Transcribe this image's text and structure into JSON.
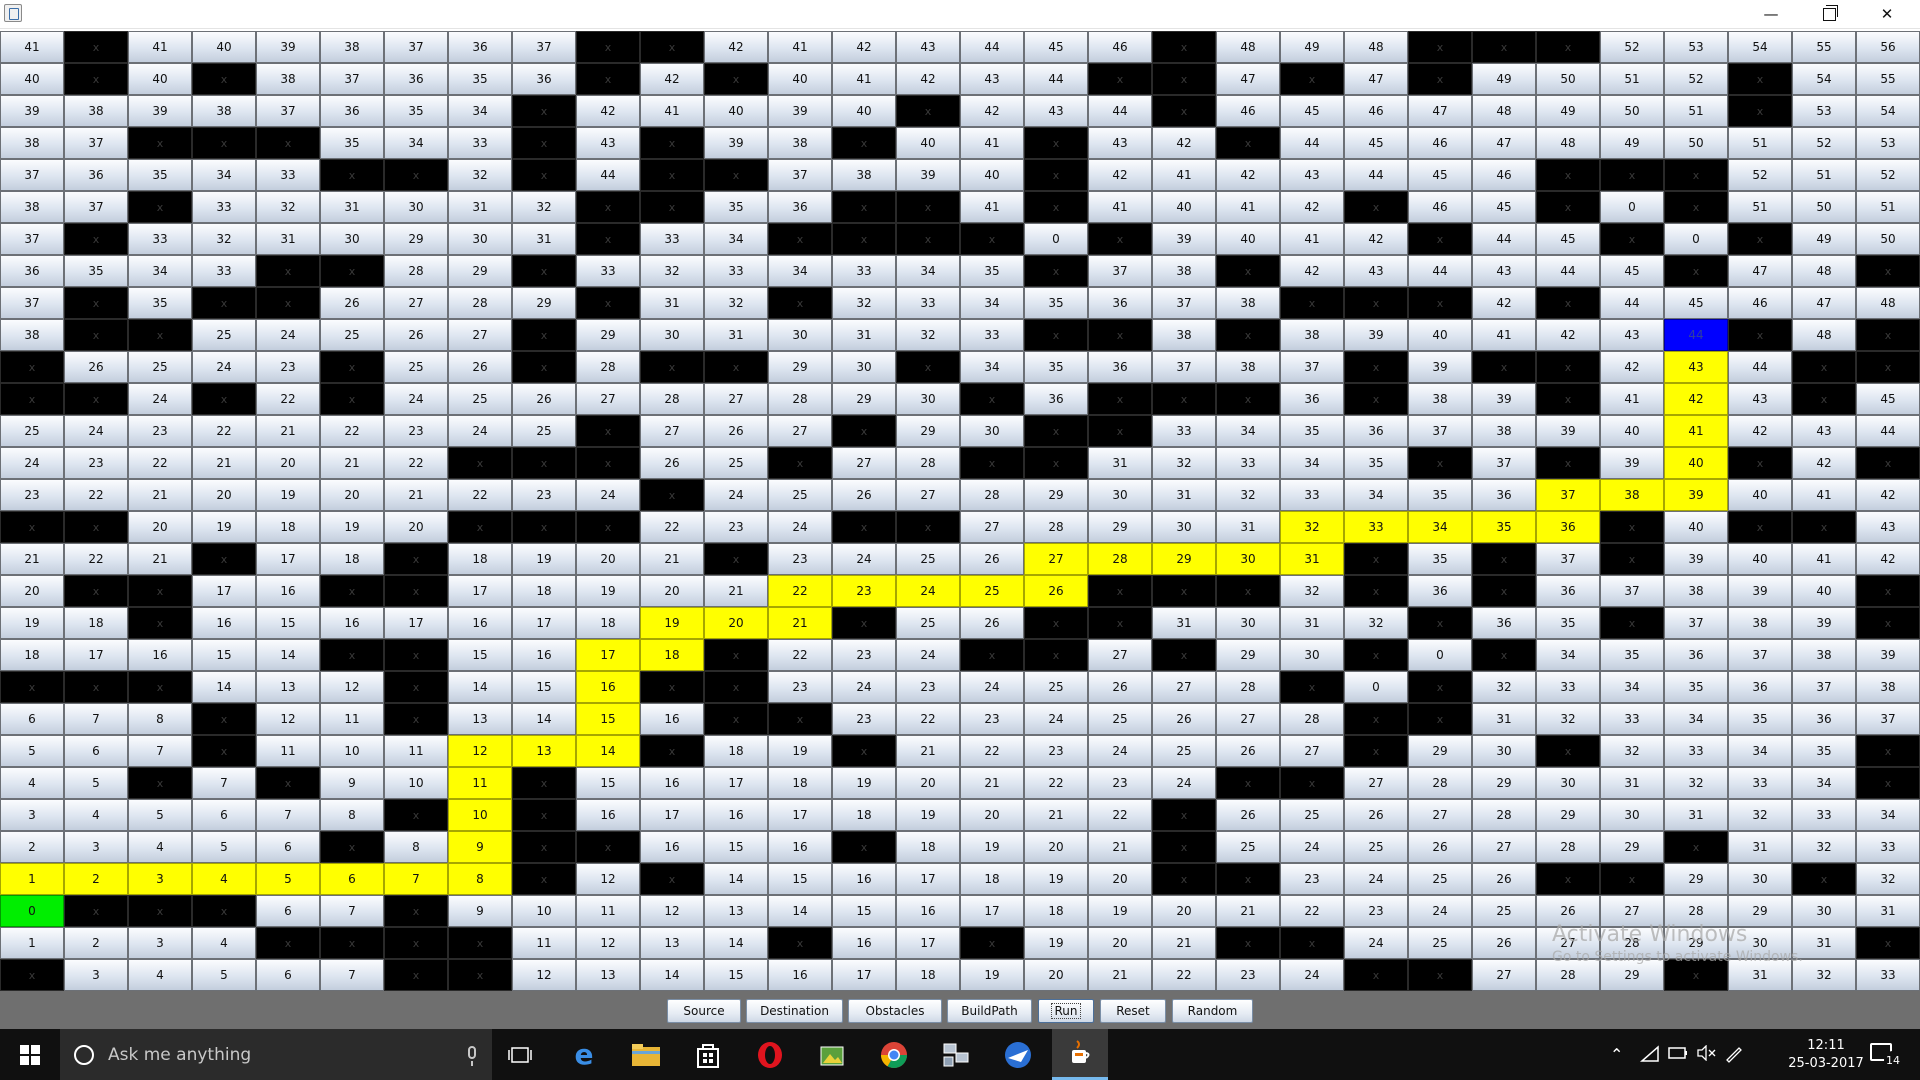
{
  "window": {
    "controls": {
      "minimize": "—",
      "close": "✕"
    }
  },
  "grid": {
    "rows": 30,
    "cols": 30,
    "obstacle_label": "x",
    "cells": [
      "41 x 41 40 39 38 37 36 37 x x 42 41 42 43 44 45 46 x 48 49 48 x x x 52 53 54 55 56",
      "40 x 40 x 38 37 36 35 36 x 42 x 40 41 42 43 44 x x 47 x 47 x 49 50 51 52 x 54 55",
      "39 38 39 38 37 36 35 34 x 42 41 40 39 40 x 42 43 44 x 46 45 46 47 48 49 50 51 x 53 54",
      "38 37 x x x 35 34 33 x 43 x 39 38 x 40 41 x 43 42 x 44 45 46 47 48 49 50 51 52 53",
      "37 36 35 34 33 x x 32 x 44 x x 37 38 39 40 x 42 41 42 43 44 45 46 x x x 52 51 52",
      "38 37 x 33 32 31 30 31 32 x x 35 36 x x 41 x 41 40 41 42 x 46 45 x 0 x 51 50 51",
      "37 x 33 32 31 30 29 30 31 x 33 34 x x x x 0 x 39 40 41 42 x 44 45 x 0 x 49 50",
      "36 35 34 33 x x 28 29 x 33 32 33 34 33 34 35 x 37 38 x 42 43 44 43 44 45 x 47 48 x",
      "37 x 35 x x 26 27 28 29 x 31 32 x 32 33 34 35 36 37 38 x x x 42 x 44 45 46 47 48",
      "38 x x 25 24 25 26 27 x 29 30 31 30 31 32 33 x x 38 x 38 39 40 41 42 43 44 x 48 x",
      "x 26 25 24 23 x 25 26 x 28 x x 29 30 x 34 35 36 37 38 37 x 39 x x 42 43 44 x x",
      "x x 24 x 22 x 24 25 26 27 28 27 28 29 30 x 36 x x x 36 x 38 39 x 41 42 43 x 45",
      "25 24 23 22 21 22 23 24 25 x 27 26 27 x 29 30 x x 33 34 35 36 37 38 39 40 41 42 43 44",
      "24 23 22 21 20 21 22 x x x 26 25 x 27 28 x x 31 32 33 34 35 x 37 x 39 40 x 42 x",
      "23 22 21 20 19 20 21 22 23 24 x 24 25 26 27 28 29 30 31 32 33 34 35 36 37 38 39 40 41 42",
      "x x 20 19 18 19 20 x x x 22 23 24 x x 27 28 29 30 31 32 33 34 35 36 x 40 x x 43",
      "21 22 21 x 17 18 x 18 19 20 21 x 23 24 25 26 27 28 29 30 31 x 35 x 37 x 39 40 41 42",
      "20 x x 17 16 x x 17 18 19 20 21 22 23 24 25 26 x x x 32 x 36 x 36 37 38 39 40 x",
      "19 18 x 16 15 16 17 16 17 18 19 20 21 x 25 26 x x 31 30 31 32 x 36 35 x 37 38 39 x",
      "18 17 16 15 14 x x 15 16 17 18 x 22 23 24 x x 27 x 29 30 x 0 x 34 35 36 37 38 39",
      "x x x 14 13 12 x 14 15 16 x x 23 24 23 24 25 26 27 28 x 0 x 32 33 34 35 36 37 38",
      "6 7 8 x 12 11 x 13 14 15 16 x x 23 22 23 24 25 26 27 28 x x 31 32 33 34 35 36 37",
      "5 6 7 x 11 10 11 12 13 14 x 18 19 x 21 22 23 24 25 26 27 x 29 30 x 32 33 34 35 x",
      "4 5 x 7 x 9 10 11 x 15 16 17 18 19 20 21 22 23 24 x x 27 28 29 30 31 32 33 34 x",
      "3 4 5 6 7 8 x 10 x 16 17 16 17 18 19 20 21 22 x 26 25 26 27 28 29 30 31 32 33 34",
      "2 3 4 5 6 x 8 9 x x 16 15 16 x 18 19 20 21 x 25 24 25 26 27 28 29 x 31 32 33",
      "1 2 3 4 5 6 7 8 x 12 x 14 15 16 17 18 19 20 x x 23 24 25 26 x x 29 30 x 32",
      "0 x x x 6 7 x 9 10 11 12 13 14 15 16 17 18 19 20 21 22 23 24 25 26 27 28 29 30 31",
      "1 2 3 4 x x x x 11 12 13 14 x 16 17 x 19 20 21 x x 24 25 26 27 28 29 30 31 x",
      "x 3 4 5 6 7 x x 12 13 14 15 16 17 18 19 20 21 22 23 24 x x 27 28 29 x 31 32 33"
    ],
    "source": [
      27,
      0
    ],
    "destination": [
      9,
      26
    ],
    "path": [
      [
        26,
        0
      ],
      [
        26,
        1
      ],
      [
        26,
        2
      ],
      [
        26,
        3
      ],
      [
        26,
        4
      ],
      [
        26,
        5
      ],
      [
        26,
        6
      ],
      [
        26,
        7
      ],
      [
        25,
        7
      ],
      [
        24,
        7
      ],
      [
        23,
        7
      ],
      [
        22,
        7
      ],
      [
        22,
        8
      ],
      [
        22,
        9
      ],
      [
        21,
        9
      ],
      [
        20,
        9
      ],
      [
        19,
        9
      ],
      [
        19,
        10
      ],
      [
        18,
        10
      ],
      [
        18,
        11
      ],
      [
        18,
        12
      ],
      [
        17,
        12
      ],
      [
        17,
        13
      ],
      [
        17,
        14
      ],
      [
        17,
        15
      ],
      [
        17,
        16
      ],
      [
        16,
        16
      ],
      [
        16,
        17
      ],
      [
        16,
        18
      ],
      [
        16,
        19
      ],
      [
        16,
        20
      ],
      [
        15,
        20
      ],
      [
        15,
        21
      ],
      [
        15,
        22
      ],
      [
        15,
        23
      ],
      [
        15,
        24
      ],
      [
        14,
        24
      ],
      [
        14,
        25
      ],
      [
        14,
        26
      ],
      [
        13,
        26
      ],
      [
        12,
        26
      ],
      [
        11,
        26
      ],
      [
        10,
        26
      ]
    ],
    "colors": {
      "source": "#00ee00",
      "destination": "#0000ff",
      "path": "#ffff00",
      "obstacle": "#000000",
      "empty": "#dde5f0"
    }
  },
  "buttons": {
    "source": "Source",
    "destination": "Destination",
    "obstacles": "Obstacles",
    "buildpath": "BuildPath",
    "run": "Run",
    "reset": "Reset",
    "random": "Random"
  },
  "watermark": {
    "line1": "Activate Windows",
    "line2": "Go to Settings to activate Windows."
  },
  "taskbar": {
    "search_placeholder": "Ask me anything",
    "apps": [
      "task-view-icon",
      "edge-icon",
      "file-explorer-icon",
      "store-icon",
      "opera-icon",
      "photo-app-icon",
      "chrome-icon",
      "network-app-icon",
      "thunderbird-icon",
      "java-app-icon"
    ],
    "time": "12:11",
    "date": "25-03-2017",
    "notification_count": "14"
  }
}
